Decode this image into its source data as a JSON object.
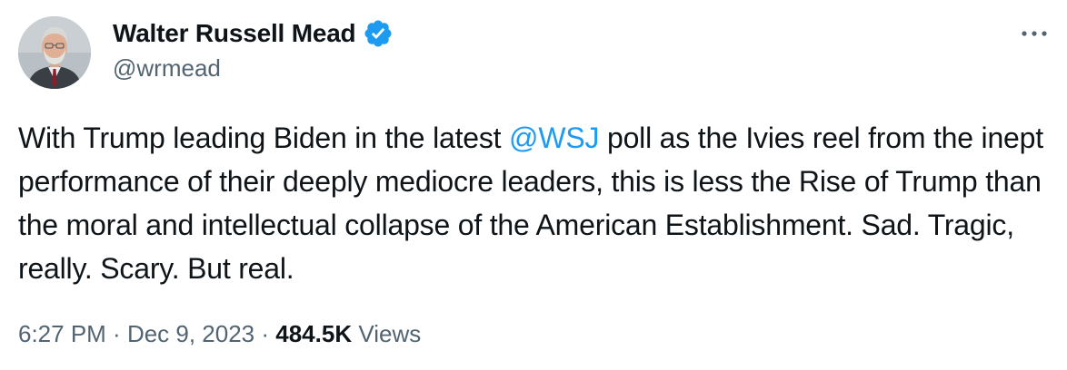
{
  "author": {
    "display_name": "Walter Russell Mead",
    "handle": "@wrmead",
    "verified_color": "#1d9bf0"
  },
  "tweet": {
    "text_before": "With Trump leading Biden in the latest ",
    "mention": "@WSJ",
    "text_after": " poll as the Ivies reel from the inept performance of their deeply mediocre leaders, this is less the Rise of Trump than the moral and intellectual collapse of the American Establishment. Sad. Tragic, really. Scary. But real."
  },
  "meta": {
    "time": "6:27 PM",
    "separator": " · ",
    "date": "Dec 9, 2023",
    "views_count": "484.5K",
    "views_label": " Views"
  },
  "icons": {
    "verified": "verified-badge-icon",
    "more": "more-options-icon",
    "avatar": "avatar-photo"
  },
  "colors": {
    "text_primary": "#0f1419",
    "text_secondary": "#536471",
    "accent": "#1d9bf0"
  }
}
